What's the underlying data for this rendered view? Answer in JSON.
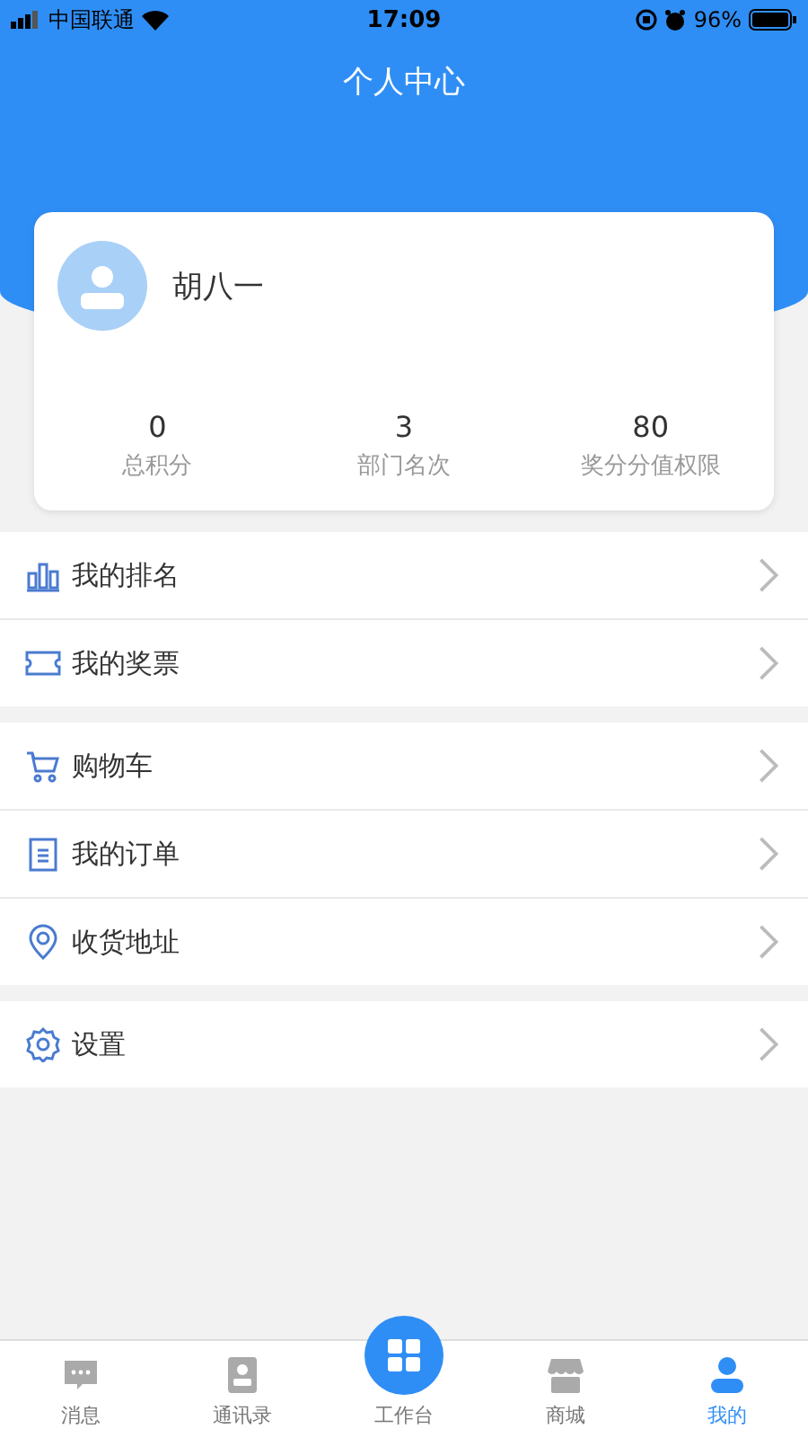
{
  "status_bar": {
    "carrier": "中国联通",
    "time": "17:09",
    "battery": "96%"
  },
  "header": {
    "title": "个人中心"
  },
  "profile": {
    "name": "胡八一",
    "stats": [
      {
        "value": "0",
        "label": "总积分"
      },
      {
        "value": "3",
        "label": "部门名次"
      },
      {
        "value": "80",
        "label": "奖分分值权限"
      }
    ]
  },
  "menu_groups": [
    {
      "items": [
        {
          "label": "我的排名"
        },
        {
          "label": "我的奖票"
        }
      ]
    },
    {
      "items": [
        {
          "label": "购物车"
        },
        {
          "label": "我的订单"
        },
        {
          "label": "收货地址"
        }
      ]
    },
    {
      "items": [
        {
          "label": "设置"
        }
      ]
    }
  ],
  "tab_bar": [
    {
      "label": "消息",
      "kind": "normal",
      "selected": false
    },
    {
      "label": "通讯录",
      "kind": "normal",
      "selected": false
    },
    {
      "label": "工作台",
      "kind": "center",
      "selected": false
    },
    {
      "label": "商城",
      "kind": "normal",
      "selected": false
    },
    {
      "label": "我的",
      "kind": "normal",
      "selected": true
    }
  ]
}
